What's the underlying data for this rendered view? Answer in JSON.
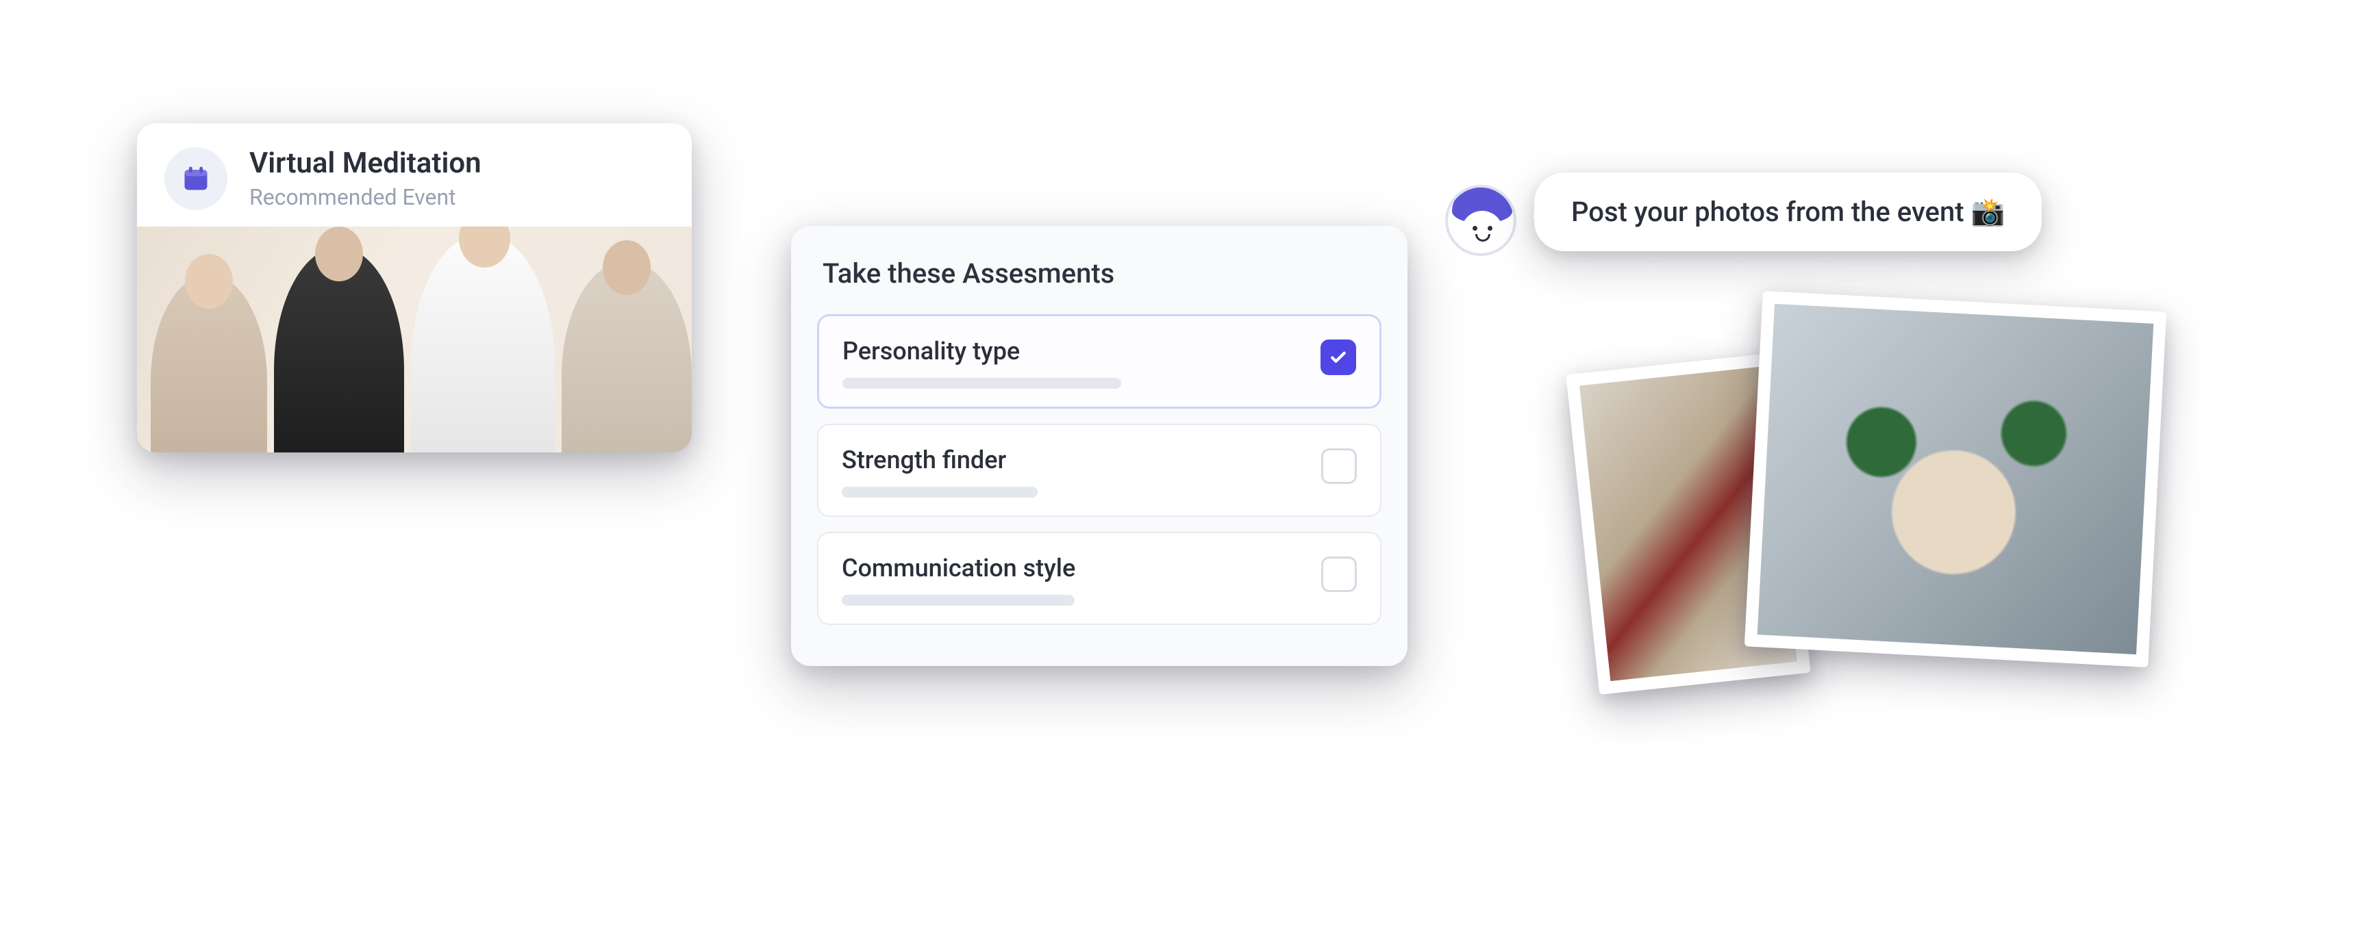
{
  "event": {
    "title": "Virtual Meditation",
    "subtitle": "Recommended Event",
    "icon": "calendar-icon"
  },
  "assessments": {
    "heading": "Take these Assesments",
    "items": [
      {
        "label": "Personality type",
        "checked": true
      },
      {
        "label": "Strength finder",
        "checked": false
      },
      {
        "label": "Communication style",
        "checked": false
      }
    ]
  },
  "prompt": {
    "text": "Post your photos from the event 📸"
  },
  "colors": {
    "accent": "#4f46e5"
  }
}
